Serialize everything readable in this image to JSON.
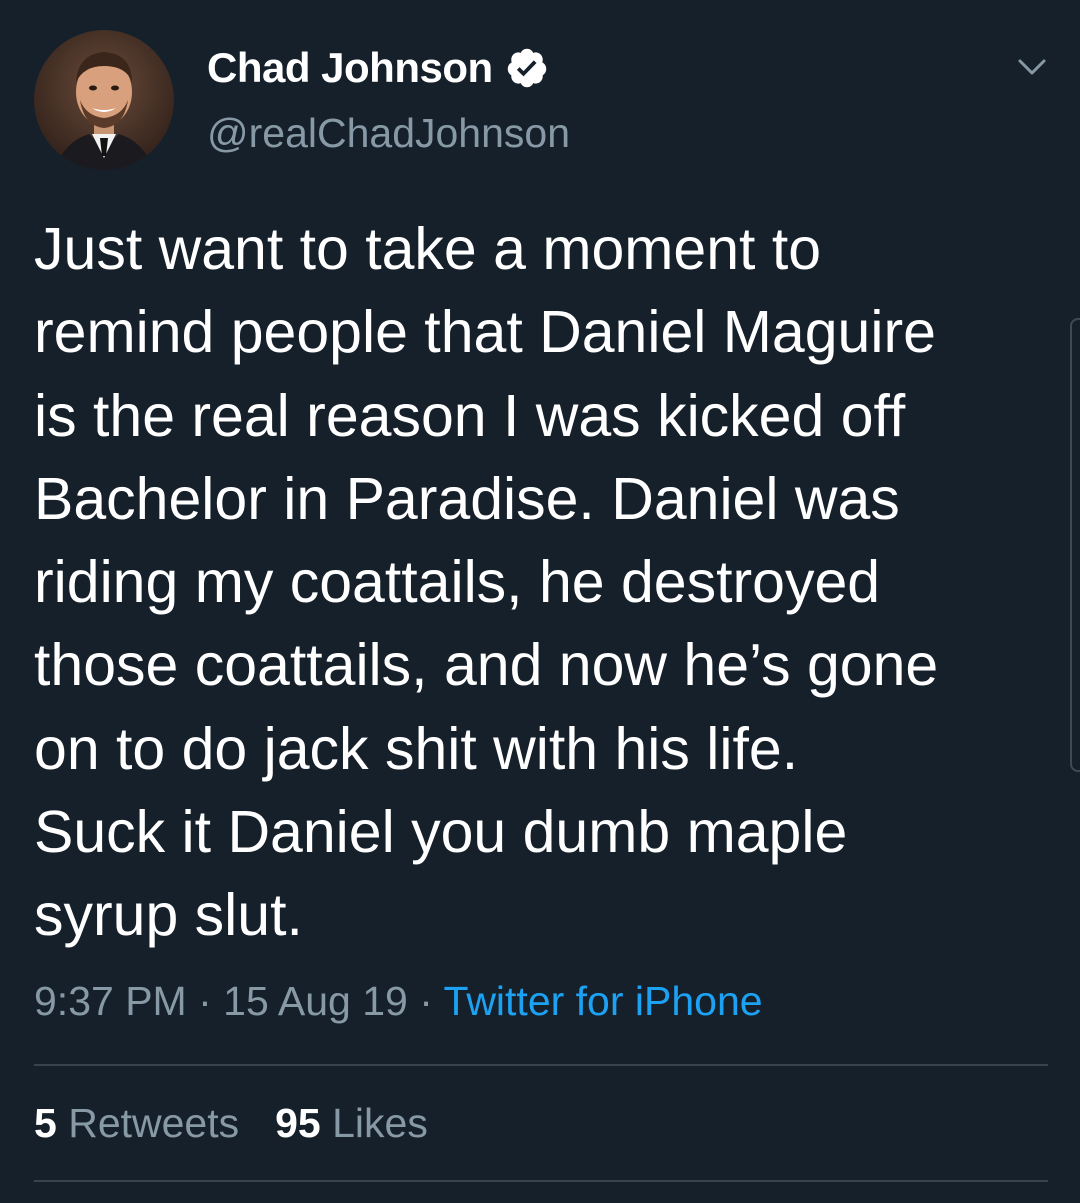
{
  "author": {
    "display_name": "Chad Johnson",
    "handle": "@realChadJohnson"
  },
  "icons": {
    "verified": "verified-badge-icon",
    "menu": "chevron-down-icon",
    "avatar": "profile-photo"
  },
  "tweet": {
    "lines": [
      "Just want to take a moment to",
      "remind people that Daniel Maguire",
      "is the real reason I was kicked off",
      "Bachelor in Paradise. Daniel was",
      "riding my coattails, he destroyed",
      "those coattails, and now he’s gone",
      "on to do jack shit with his life.",
      "Suck it Daniel you dumb maple",
      "syrup slut."
    ]
  },
  "meta": {
    "time": "9:37 PM",
    "separator": " · ",
    "date": "15 Aug 19",
    "source": "Twitter for iPhone"
  },
  "stats": {
    "retweets_count": "5",
    "retweets_label": " Retweets",
    "likes_count": "95",
    "likes_label": " Likes"
  },
  "colors": {
    "background": "#15202b",
    "text": "#ffffff",
    "secondary": "#8899a6",
    "link": "#1da1f2",
    "divider": "#38444d"
  }
}
